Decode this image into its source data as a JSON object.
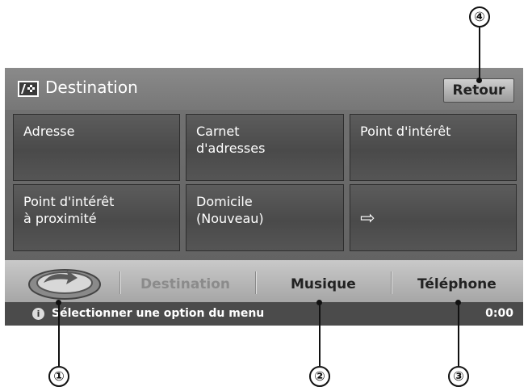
{
  "header": {
    "title": "Destination",
    "back_label": "Retour"
  },
  "menu": {
    "items": [
      {
        "label": "Adresse"
      },
      {
        "label": "Carnet\nd'adresses"
      },
      {
        "label": "Point d'intérêt"
      },
      {
        "label": "Point d'intérêt\nà proximité"
      },
      {
        "label": "Domicile\n(Nouveau)"
      },
      {
        "label": "⇨"
      }
    ]
  },
  "tabs": {
    "destination": "Destination",
    "music": "Musique",
    "phone": "Téléphone"
  },
  "status": {
    "message": "Sélectionner une option du menu",
    "time": "0:00"
  },
  "callouts": {
    "c1": "①",
    "c2": "②",
    "c3": "③",
    "c4": "④"
  }
}
